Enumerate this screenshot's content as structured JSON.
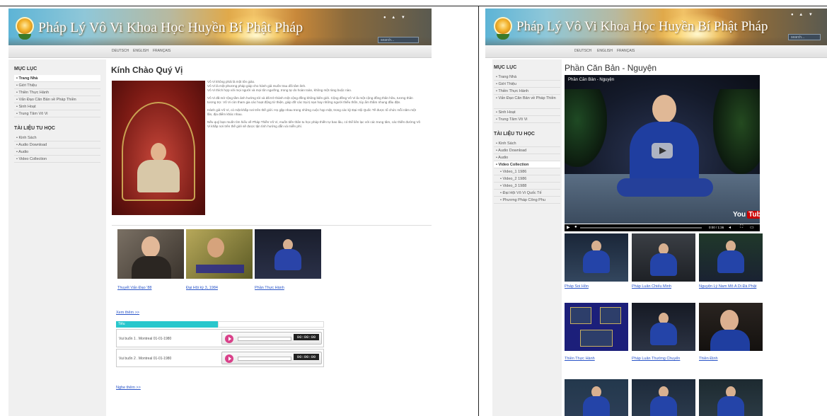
{
  "colors": {
    "banner_left": "#5db4d6",
    "banner_mid": "#e0a94a",
    "table_header": "#29c7cc",
    "link": "#2a55c8",
    "play_button": "#d9418a"
  },
  "site": {
    "title": "Pháp Lý Vô Vi Khoa Học Huyền Bí Phật Pháp"
  },
  "left": {
    "langs": [
      "DEUTSCH",
      "ENGLISH",
      "FRANÇAIS"
    ],
    "search_placeholder": "search...",
    "menu_title": "MỤC LỤC",
    "menu": [
      "Trang Nhà",
      "Giới Thiệu",
      "Thiền Thực Hành",
      "Vấn Đạo Căn Bản về Pháp Thiền",
      "Sinh Hoạt",
      "Trung Tâm Vô Vi"
    ],
    "docs_title": "TÀI LIỆU TU HỌC",
    "docs": [
      "Kinh Sách",
      "Audio Download",
      "Audio",
      "Video Collection"
    ],
    "page_title": "Kính Chào Quý Vị",
    "paragraphs": [
      "Vô Vi không phải là một tôn giáo.",
      "Vô Vi là một phương pháp giúp cho hành giả muốn trau dồi tâm linh.",
      "Vô Vi thích hợp với mọi người và mọi tôn ngưỡng, trong tự do hoàn toàn, không một ràng buộc nào.",
      "Vô Vi đã mở rộng tầm ảnh hưởng tới và đã trở thành một cộng đồng không biên giới. Cộng đồng Vô Vi là một cộng đồng thân hữu, tương thân tương trợ. Vô Vi còn tham gia các hoạt động từ thiện, giúp đỡ các trại tị nạn hay những người thiếu thốn, tùy ẩm thầm nhung đầu đặn.",
      "Hành giả Vô Vi, có mặt khắp nơi trên thế giới. Họ gặp nhau trong những cuộc họp mặt, trong các kỳ Đại Hội Quốc Tế được tổ chức mỗi năm một lần, địa điểm khác nhau.",
      "Nếu quý bạn muốn tìm hiểu về Pháp Thiền Vô Vi, muốn tiến thân tu học pháp thiền tự bao lâu, có thể liên lạc với các trung tâm, các thiền đường Vô Vi khắp nơi trên thế giới sẽ được tận tình hướng dẫn và miễn phí."
    ],
    "video_captions": [
      "Thuyết Vấn Đạo '88",
      "Đại Hội kỳ 3, 1984",
      "Phần Thực Hành"
    ],
    "see_more": "Xem thêm >>",
    "table_header": "Tiêu",
    "audio_rows": [
      {
        "title": "Vui buổn 1 . Montreal 01-01-1980",
        "time": "00:00:00"
      },
      {
        "title": "Vui buổn 2 . Montreal 01-01-1980",
        "time": "00:00:00"
      }
    ],
    "listen_more": "Nghe thêm >>"
  },
  "right": {
    "langs": [
      "DEUTSCH",
      "ENGLISH",
      "FRANÇAIS"
    ],
    "search_placeholder": "search...",
    "menu_title": "MỤC LỤC",
    "menu": [
      "Trang Nhà",
      "Giới Thiệu",
      "Thiền Thực Hành",
      "Vấn Đạo Căn Bản về Pháp Thiền",
      "Sinh Hoạt",
      "Trung Tâm Vô Vi"
    ],
    "docs_title": "TÀI LIỆU TU HỌC",
    "docs": [
      "Kinh Sách",
      "Audio Download",
      "Audio",
      "Video Collection"
    ],
    "video_sub": [
      "Video_1 1986",
      "Video_2 1986",
      "Video_3 1988",
      "Đại Hội Vô Vi Quốc Tế",
      "Phương Pháp Công Phu"
    ],
    "page_title": "Phần Căn Bản - Nguyện",
    "video_overlay_title": "Phần Căn Bản - Nguyện",
    "video_time": "0:00 / 1:36",
    "yt_logo_a": "You",
    "yt_logo_b": "Tube",
    "thumb_captions_row1": [
      "Pháp Soi Hồn",
      "Pháp Luân Chiếu Minh",
      "Nguyện Lý Nam Mô A Di Đà Phật"
    ],
    "thumb_captions_row2": [
      "Thiền Thực Hành",
      "Pháp Luân Thường Chuyển",
      "Thiền Định"
    ]
  }
}
